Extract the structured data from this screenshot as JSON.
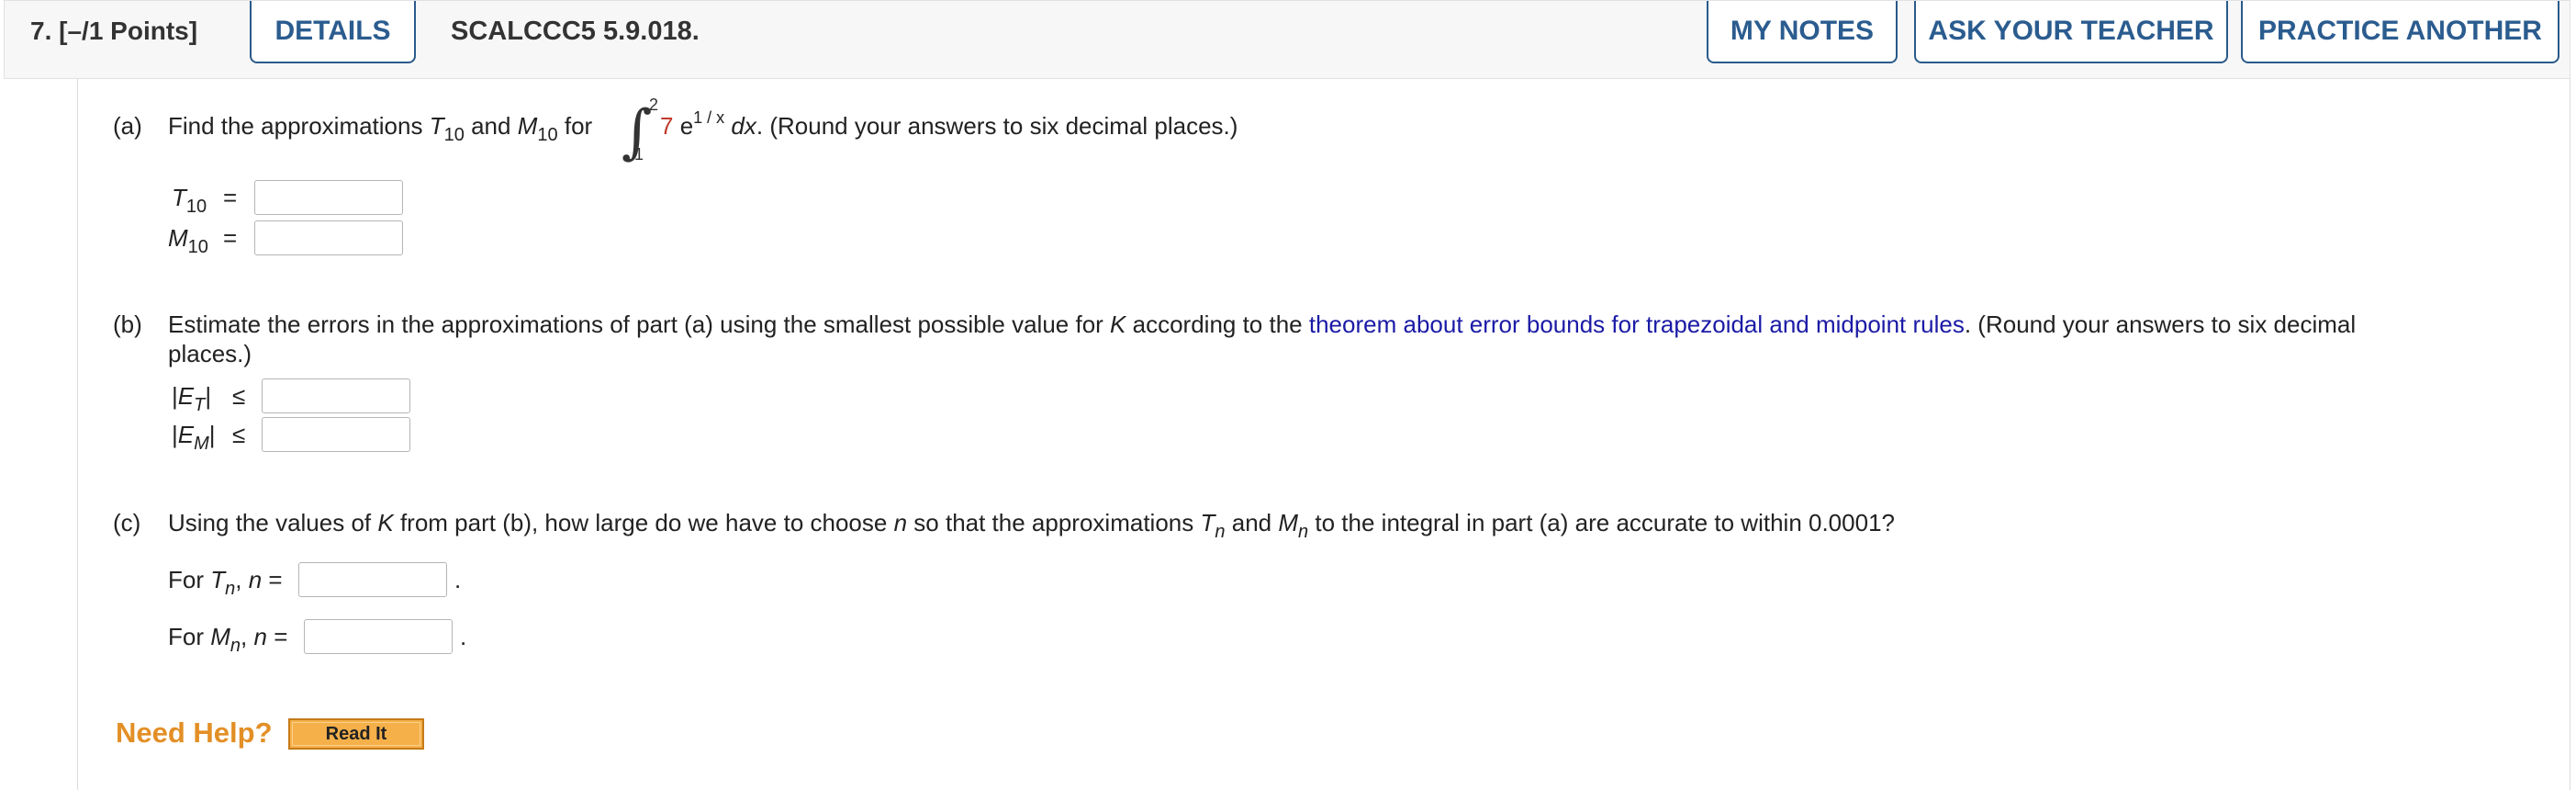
{
  "header": {
    "question_number": "7.",
    "points": "[–/1 Points]",
    "details_label": "DETAILS",
    "question_id": "SCALCCC5 5.9.018.",
    "my_notes_label": "MY NOTES",
    "ask_teacher_label": "ASK YOUR TEACHER",
    "practice_another_label": "PRACTICE ANOTHER"
  },
  "part_a": {
    "marker": "(a)",
    "find_text": "Find the approximations",
    "T": "T",
    "M": "M",
    "n10": "10",
    "and_text": "and",
    "for_text": "for",
    "integral_sign": "∫",
    "upper_limit": "2",
    "lower_limit": "1",
    "coefficient": "7",
    "e_text": "e",
    "exponent": "1 / x",
    "dx": "dx",
    "round_text": ". (Round your answers to six decimal places.)",
    "equals": "=",
    "T10_value": "",
    "M10_value": ""
  },
  "part_b": {
    "marker": "(b)",
    "text_before": "Estimate the errors in the approximations of part (a) using the smallest possible value for",
    "K": "K",
    "text_mid": "according to the",
    "link_text": "theorem about error bounds for trapezoidal and midpoint rules",
    "text_after": ". (Round your answers to six decimal",
    "text_line2": "places.)",
    "bar": "|",
    "E": "E",
    "T_sub": "T",
    "M_sub": "M",
    "leq": "≤",
    "ET_value": "",
    "EM_value": ""
  },
  "part_c": {
    "marker": "(c)",
    "text1": "Using the values of",
    "K": "K",
    "text2": "from part (b), how large do we have to choose",
    "n": "n",
    "text3": "so that the approximations",
    "T": "T",
    "and_text": "and",
    "M": "M",
    "text4": "to the integral in part (a) are accurate to within 0.0001?",
    "for_text": "For",
    "comma": ",",
    "equals": "=",
    "period": ".",
    "Tn_value": "",
    "Mn_value": ""
  },
  "help": {
    "need_help": "Need Help?",
    "read_it": "Read It"
  }
}
